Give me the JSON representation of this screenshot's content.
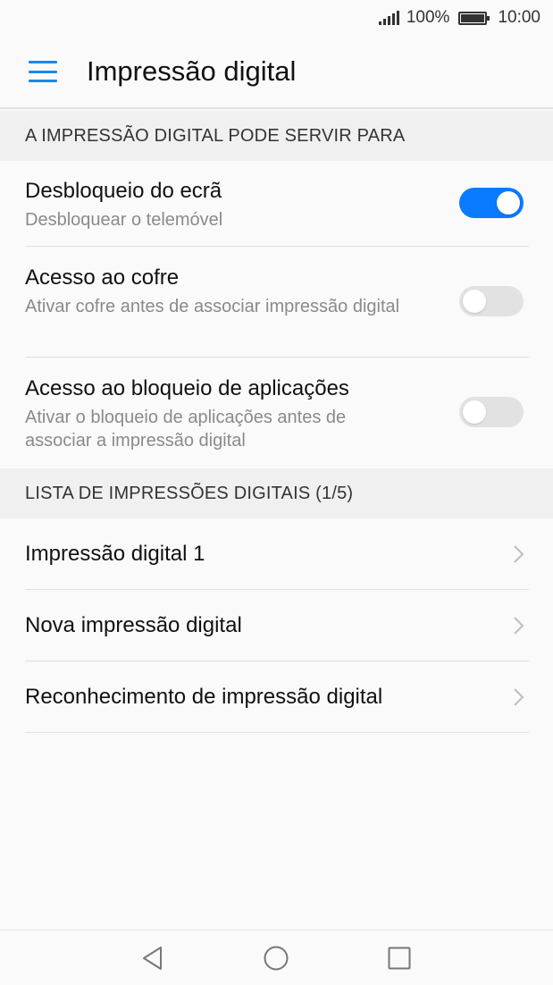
{
  "status": {
    "signal_icon": "signal-icon",
    "battery_text": "100%",
    "battery_level": 1.0,
    "time": "10:00"
  },
  "app_bar": {
    "menu_icon": "menu-icon",
    "title": "Impressão digital"
  },
  "section1": {
    "header": "A IMPRESSÃO DIGITAL PODE SERVIR PARA"
  },
  "toggles": [
    {
      "title": "Desbloqueio do ecrã",
      "subtitle": "Desbloquear o telemóvel",
      "on": true
    },
    {
      "title": "Acesso ao cofre",
      "subtitle": "Ativar cofre antes de associar impressão digital",
      "on": false
    },
    {
      "title": "Acesso ao bloqueio de aplicações",
      "subtitle": "Ativar o bloqueio de aplicações antes de associar a impressão digital",
      "on": false
    }
  ],
  "section2": {
    "header": "LISTA DE IMPRESSÕES DIGITAIS (1/5)"
  },
  "list": [
    {
      "label": "Impressão digital 1",
      "icon": "chevron-right-icon"
    },
    {
      "label": "Nova impressão digital",
      "icon": "chevron-right-icon"
    },
    {
      "label": "Reconhecimento de impressão digital",
      "icon": "chevron-right-icon"
    }
  ],
  "nav": {
    "back": "back-triangle-icon",
    "home": "home-circle-icon",
    "recents": "recents-square-icon"
  },
  "colors": {
    "accent": "#1e88e5",
    "switch_on": "#0a7aff",
    "switch_off": "#e2e2e2"
  }
}
